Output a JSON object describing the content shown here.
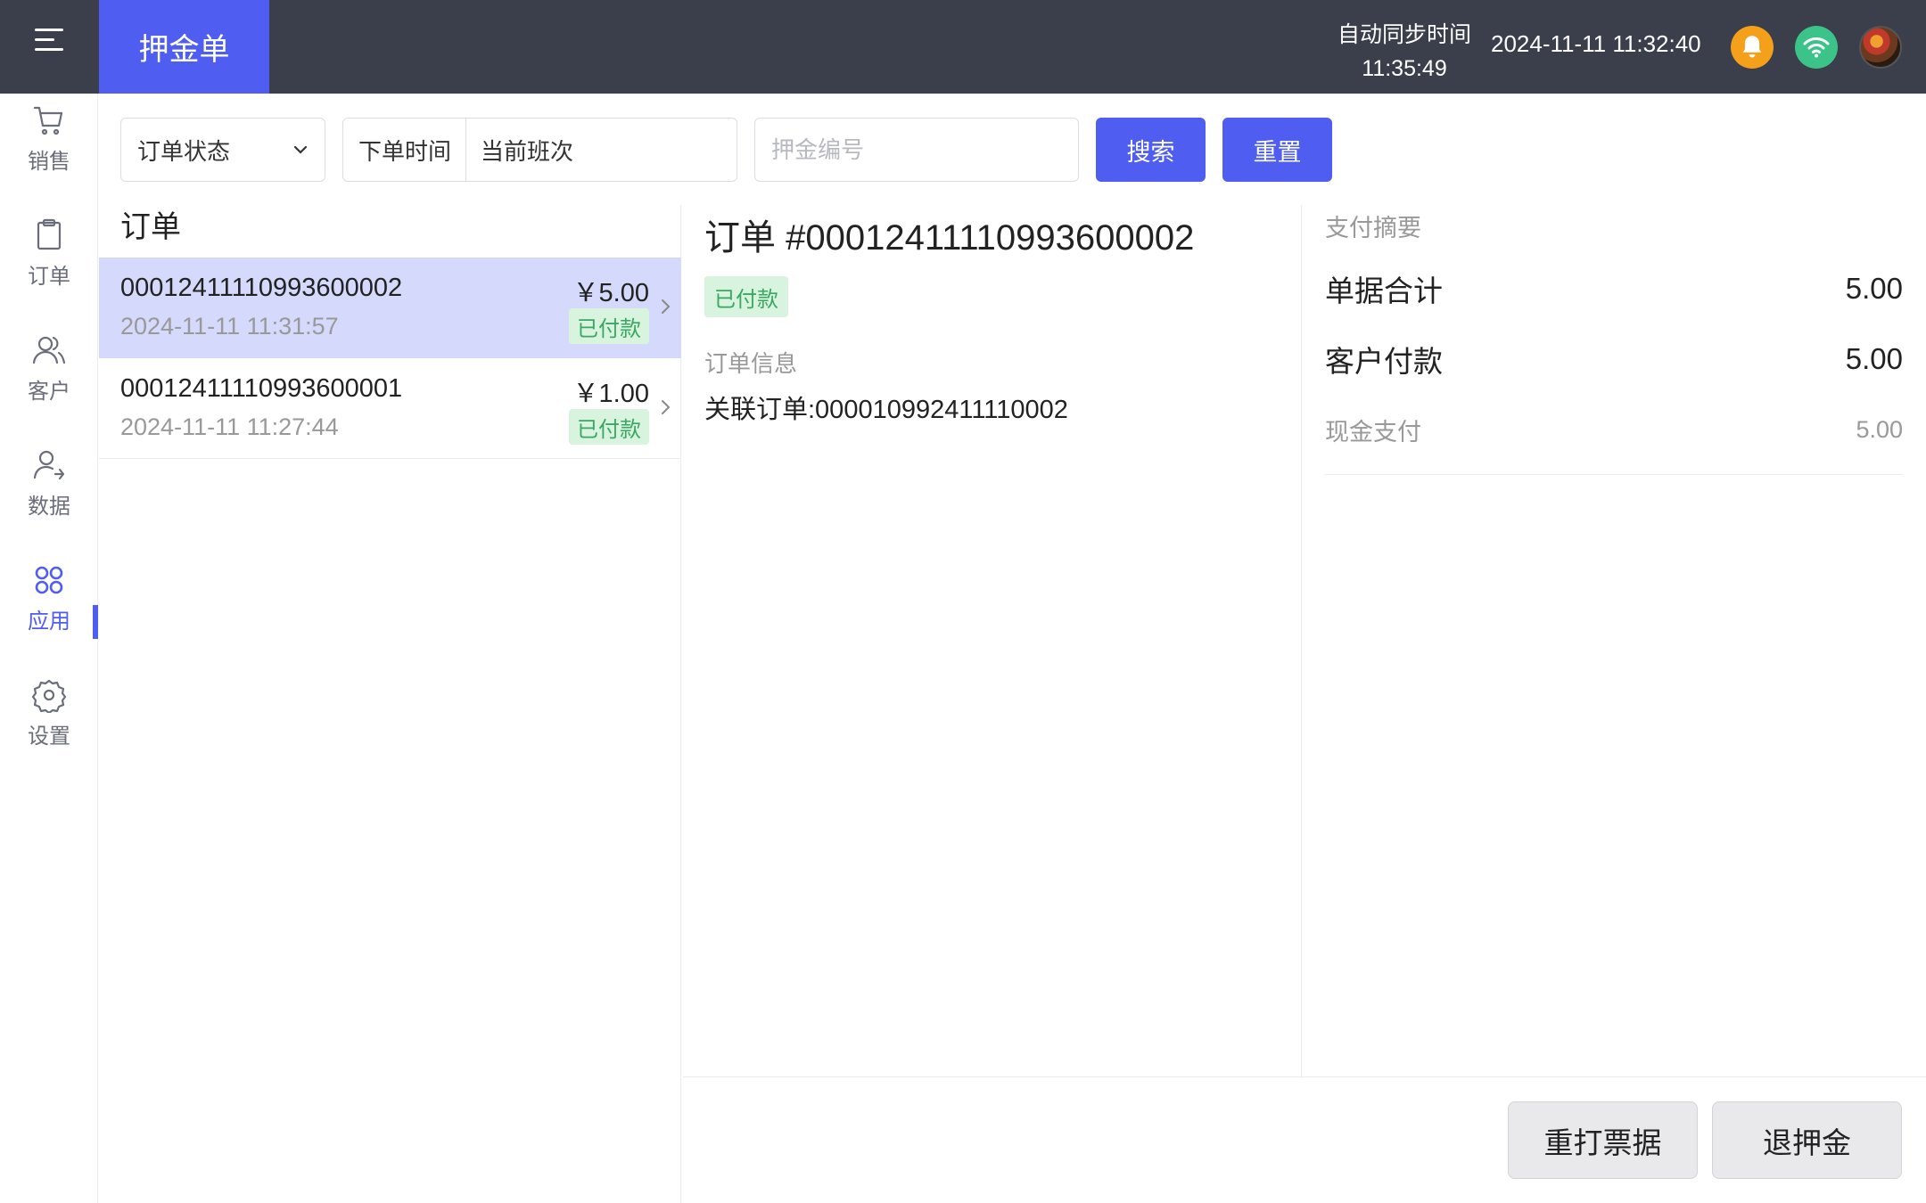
{
  "header": {
    "page_title": "押金单",
    "sync_label": "自动同步时间",
    "sync_time": "11:35:49",
    "current_datetime": "2024-11-11 11:32:40"
  },
  "sidebar": {
    "items": [
      {
        "label": "销售",
        "icon": "cart-icon"
      },
      {
        "label": "订单",
        "icon": "clipboard-icon"
      },
      {
        "label": "客户",
        "icon": "users-icon"
      },
      {
        "label": "数据",
        "icon": "user-arrow-icon"
      },
      {
        "label": "应用",
        "icon": "apps-icon",
        "active": true
      },
      {
        "label": "设置",
        "icon": "gear-icon"
      }
    ]
  },
  "filters": {
    "status_select": "订单状态",
    "time_label": "下单时间",
    "time_value": "当前班次",
    "deposit_placeholder": "押金编号",
    "search_label": "搜索",
    "reset_label": "重置"
  },
  "orders": {
    "title": "订单",
    "items": [
      {
        "id": "00012411110993600002",
        "time": "2024-11-11 11:31:57",
        "amount": "￥5.00",
        "status": "已付款",
        "selected": true
      },
      {
        "id": "00012411110993600001",
        "time": "2024-11-11 11:27:44",
        "amount": "￥1.00",
        "status": "已付款",
        "selected": false
      }
    ]
  },
  "detail": {
    "title": "订单 #00012411110993600002",
    "status": "已付款",
    "section_label": "订单信息",
    "linked_order": "关联订单:000010992411110002"
  },
  "summary": {
    "heading": "支付摘要",
    "total_label": "单据合计",
    "total_value": "5.00",
    "paid_label": "客户付款",
    "paid_value": "5.00",
    "cash_label": "现金支付",
    "cash_value": "5.00"
  },
  "actions": {
    "reprint_label": "重打票据",
    "refund_label": "退押金"
  },
  "colors": {
    "primary": "#4f5df0",
    "topbar": "#3b3e4b",
    "badge_bg": "#d8f3de",
    "badge_text": "#3aa864",
    "bell": "#f5a01a",
    "wifi": "#3cc38a"
  }
}
